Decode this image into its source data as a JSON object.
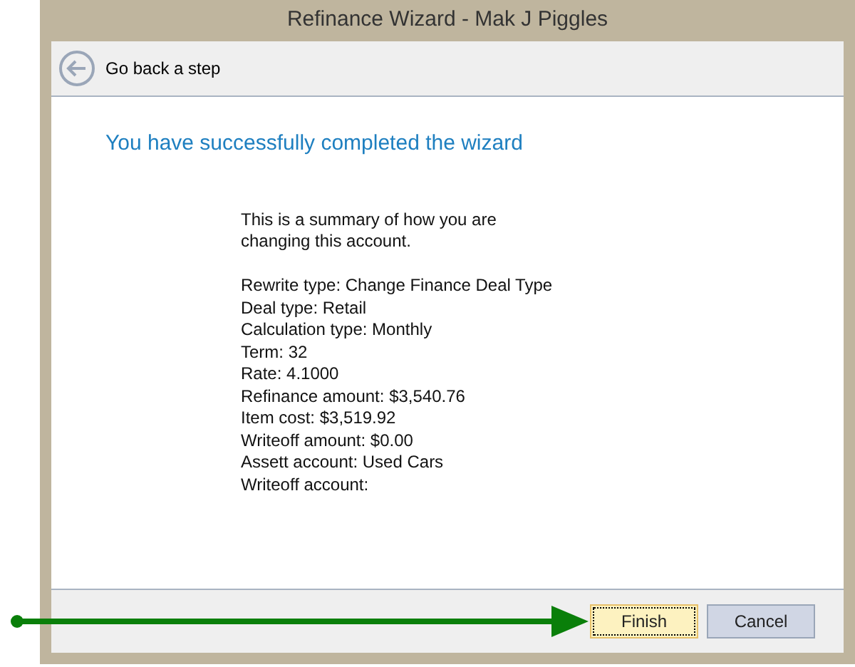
{
  "window": {
    "title": "Refinance Wizard - Mak J Piggles"
  },
  "back_link": {
    "label": "Go back a step"
  },
  "heading": "You have successfully completed the wizard",
  "summary": {
    "intro": "This is a summary of how you are changing this account.",
    "lines": [
      "Rewrite type: Change Finance Deal Type",
      "Deal type: Retail",
      "Calculation type: Monthly",
      "Term: 32",
      "Rate: 4.1000",
      "Refinance amount: $3,540.76",
      "Item cost: $3,519.92",
      "Writeoff amount: $0.00",
      "Assett account: Used Cars",
      "Writeoff account:"
    ]
  },
  "buttons": [
    {
      "label": "Finish",
      "focused": true
    },
    {
      "label": "Cancel",
      "focused": false
    }
  ]
}
